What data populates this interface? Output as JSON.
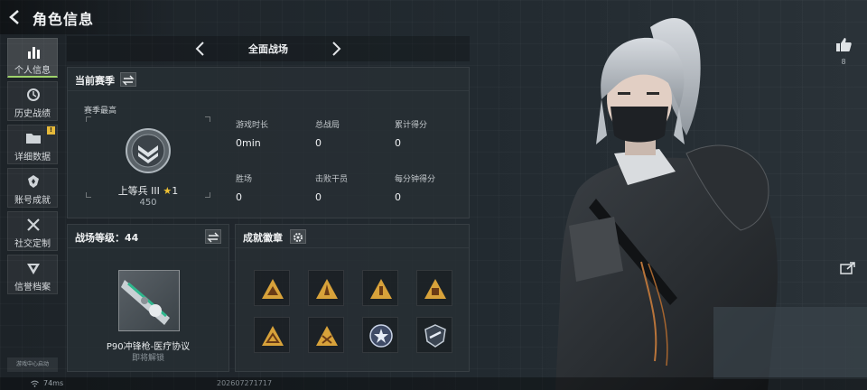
{
  "header": {
    "title": "角色信息",
    "back_icon": "back-arrow-icon"
  },
  "sidebar": {
    "items": [
      {
        "label": "个人信息",
        "icon": "bar-chart-icon",
        "active": true
      },
      {
        "label": "历史战绩",
        "icon": "history-icon",
        "active": false
      },
      {
        "label": "详细数据",
        "icon": "folder-icon",
        "active": false,
        "badge": "!"
      },
      {
        "label": "账号成就",
        "icon": "achievement-icon",
        "active": false
      },
      {
        "label": "社交定制",
        "icon": "tools-icon",
        "active": false
      },
      {
        "label": "信誉档案",
        "icon": "credit-icon",
        "active": false
      }
    ],
    "game_center": "游戏中心启动"
  },
  "mode": {
    "title": "全面战场"
  },
  "season": {
    "title": "当前赛季",
    "best_label": "赛季最高",
    "rank_name": "上等兵 III",
    "rank_stars": "1",
    "rank_score": "450",
    "stats": [
      {
        "label": "游戏时长",
        "value": "0min"
      },
      {
        "label": "总战局",
        "value": "0"
      },
      {
        "label": "累计得分",
        "value": "0"
      },
      {
        "label": "胜场",
        "value": "0"
      },
      {
        "label": "击败干员",
        "value": "0"
      },
      {
        "label": "每分钟得分",
        "value": "0"
      }
    ]
  },
  "battle_level": {
    "title": "战场等级：44",
    "weapon_name": "P90冲锋枪-医疗协议",
    "weapon_status": "即将解锁"
  },
  "achievements": {
    "title": "成就徽章",
    "settings_icon": "gear-icon",
    "badges": [
      "badge-triangle-1",
      "badge-triangle-2",
      "badge-triangle-3",
      "badge-triangle-4",
      "badge-triangle-5",
      "badge-triangle-6",
      "badge-star-shield",
      "badge-round-shield"
    ]
  },
  "social": {
    "like_count": "8"
  },
  "footer": {
    "ping": "74ms",
    "uid": "202607271717"
  },
  "colors": {
    "accent": "#9fd36b",
    "badge_gold": "#d8a23a",
    "star": "#f0c234"
  }
}
